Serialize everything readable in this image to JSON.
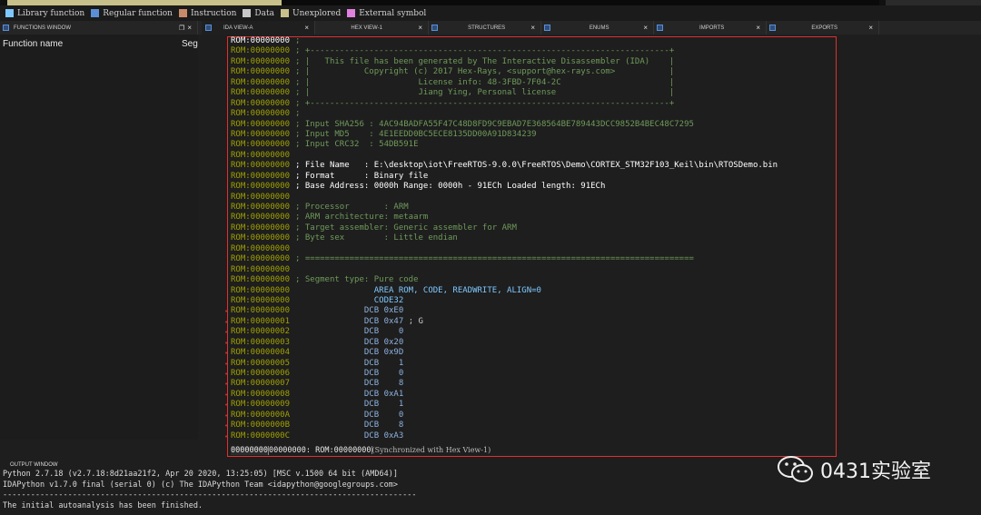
{
  "legend": [
    {
      "label": "Library function",
      "color": "#7ec8ff"
    },
    {
      "label": "Regular function",
      "color": "#5a8fd8"
    },
    {
      "label": "Instruction",
      "color": "#c98a6a"
    },
    {
      "label": "Data",
      "color": "#c7c7c7"
    },
    {
      "label": "Unexplored",
      "color": "#c8c08a"
    },
    {
      "label": "External symbol",
      "color": "#e080e0"
    }
  ],
  "tabs": {
    "functions": "FUNCTIONS WINDOW",
    "ida_view": "IDA VIEW-A",
    "hex_view": "HEX VIEW-1",
    "structures": "STRUCTURES",
    "enums": "ENUMS",
    "imports": "IMPORTS",
    "exports": "EXPORTS",
    "close": "×"
  },
  "functions_window": {
    "col_name": "Function name",
    "col_seg": "Seg"
  },
  "listing": [
    {
      "addr": "ROM:00000000",
      "t": ";",
      "cls": "c"
    },
    {
      "addr": "ROM:00000000",
      "t": "; +-------------------------------------------------------------------------+",
      "cls": "c"
    },
    {
      "addr": "ROM:00000000",
      "t": "; |   This file has been generated by The Interactive Disassembler (IDA)    |",
      "cls": "c"
    },
    {
      "addr": "ROM:00000000",
      "t": "; |           Copyright (c) 2017 Hex-Rays, <support@hex-rays.com>           |",
      "cls": "c"
    },
    {
      "addr": "ROM:00000000",
      "t": "; |                      License info: 48-3FBD-7F04-2C                      |",
      "cls": "c"
    },
    {
      "addr": "ROM:00000000",
      "t": "; |                      Jiang Ying, Personal license                       |",
      "cls": "c"
    },
    {
      "addr": "ROM:00000000",
      "t": "; +-------------------------------------------------------------------------+",
      "cls": "c"
    },
    {
      "addr": "ROM:00000000",
      "t": ";",
      "cls": "c"
    },
    {
      "addr": "ROM:00000000",
      "t": "; Input SHA256 : 4AC94BADFA55F47C48D8FD9C9EBAD7E368564BE789443DCC9852B4BEC48C7295",
      "cls": "c"
    },
    {
      "addr": "ROM:00000000",
      "t": "; Input MD5    : 4E1EEDD0BC5ECE8135DD00A91D834239",
      "cls": "c"
    },
    {
      "addr": "ROM:00000000",
      "t": "; Input CRC32  : 54DB591E",
      "cls": "c"
    },
    {
      "addr": "ROM:00000000",
      "t": "",
      "cls": "c"
    },
    {
      "addr": "ROM:00000000",
      "t": "; File Name   : E:\\desktop\\iot\\FreeRTOS-9.0.0\\FreeRTOS\\Demo\\CORTEX_STM32F103_Keil\\bin\\RTOSDemo.bin",
      "cls": "w"
    },
    {
      "addr": "ROM:00000000",
      "t": "; Format      : Binary file",
      "cls": "w"
    },
    {
      "addr": "ROM:00000000",
      "t": "; Base Address: 0000h Range: 0000h - 91ECh Loaded length: 91ECh",
      "cls": "w"
    },
    {
      "addr": "ROM:00000000",
      "t": "",
      "cls": "c"
    },
    {
      "addr": "ROM:00000000",
      "t": "; Processor       : ARM",
      "cls": "c"
    },
    {
      "addr": "ROM:00000000",
      "t": "; ARM architecture: metaarm",
      "cls": "c"
    },
    {
      "addr": "ROM:00000000",
      "t": "; Target assembler: Generic assembler for ARM",
      "cls": "c"
    },
    {
      "addr": "ROM:00000000",
      "t": "; Byte sex        : Little endian",
      "cls": "c"
    },
    {
      "addr": "ROM:00000000",
      "t": "",
      "cls": "c"
    },
    {
      "addr": "ROM:00000000",
      "t": "; ===============================================================================",
      "cls": "c"
    },
    {
      "addr": "ROM:00000000",
      "t": "",
      "cls": "c"
    },
    {
      "addr": "ROM:00000000",
      "t": "; Segment type: Pure code",
      "cls": "c"
    },
    {
      "addr": "ROM:00000000",
      "t": "                AREA ROM, CODE, READWRITE, ALIGN=0",
      "cls": "k"
    },
    {
      "addr": "ROM:00000000",
      "t": "                CODE32",
      "cls": "k"
    },
    {
      "addr": "ROM:00000000",
      "op": "DCB",
      "val": "0xE0",
      "cm": "",
      "mark": true
    },
    {
      "addr": "ROM:00000001",
      "op": "DCB",
      "val": "0x47",
      "cm": "; G",
      "mark": true
    },
    {
      "addr": "ROM:00000002",
      "op": "DCB",
      "val": "   0",
      "cm": "",
      "mark": true
    },
    {
      "addr": "ROM:00000003",
      "op": "DCB",
      "val": "0x20",
      "cm": "",
      "mark": true
    },
    {
      "addr": "ROM:00000004",
      "op": "DCB",
      "val": "0x9D",
      "cm": "",
      "mark": true
    },
    {
      "addr": "ROM:00000005",
      "op": "DCB",
      "val": "   1",
      "cm": "",
      "mark": true
    },
    {
      "addr": "ROM:00000006",
      "op": "DCB",
      "val": "   0",
      "cm": "",
      "mark": true
    },
    {
      "addr": "ROM:00000007",
      "op": "DCB",
      "val": "   8",
      "cm": "",
      "mark": true
    },
    {
      "addr": "ROM:00000008",
      "op": "DCB",
      "val": "0xA1",
      "cm": "",
      "mark": true
    },
    {
      "addr": "ROM:00000009",
      "op": "DCB",
      "val": "   1",
      "cm": "",
      "mark": true
    },
    {
      "addr": "ROM:0000000A",
      "op": "DCB",
      "val": "   0",
      "cm": "",
      "mark": true
    },
    {
      "addr": "ROM:0000000B",
      "op": "DCB",
      "val": "   8",
      "cm": "",
      "mark": true
    },
    {
      "addr": "ROM:0000000C",
      "op": "DCB",
      "val": "0xA3",
      "cm": "",
      "mark": true
    }
  ],
  "status": {
    "pos": "00000000",
    "loc": "00000000: ROM:00000000",
    "sync": "(Synchronized with Hex View-1)"
  },
  "output": {
    "title": "OUTPUT WINDOW",
    "lines": [
      "Python 2.7.18 (v2.7.18:8d21aa21f2, Apr 20 2020, 13:25:05) [MSC v.1500 64 bit (AMD64)]",
      "IDAPython v1.7.0 final (serial 0) (c) The IDAPython Team <idapython@googlegroups.com>",
      "-----------------------------------------------------------------------------------------",
      "The initial autoanalysis has been finished."
    ]
  },
  "watermark": "0431实验室"
}
